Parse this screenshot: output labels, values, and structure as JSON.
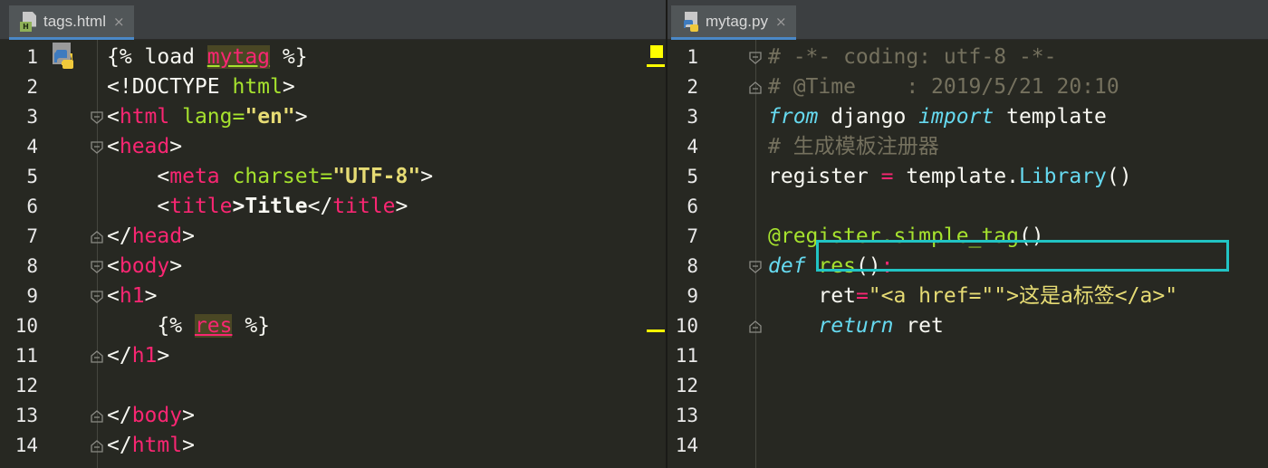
{
  "left_tab": {
    "label": "tags.html",
    "icon": "html-file-icon",
    "close": "×"
  },
  "right_tab": {
    "label": "mytag.py",
    "icon": "python-file-icon",
    "close": "×"
  },
  "left_lines": [
    {
      "n": "1",
      "segs": [
        [
          "plain",
          "{% load "
        ],
        [
          "tmpl-name tag",
          "mytag"
        ],
        [
          "plain",
          " %}"
        ]
      ]
    },
    {
      "n": "2",
      "segs": [
        [
          "plain",
          "<!DOCTYPE "
        ],
        [
          "attr",
          "html"
        ],
        [
          "plain",
          ">"
        ]
      ]
    },
    {
      "n": "3",
      "segs": [
        [
          "plain",
          "<"
        ],
        [
          "tag",
          "html "
        ],
        [
          "attr",
          "lang="
        ],
        [
          "str",
          "\"en\""
        ],
        [
          "plain",
          ">"
        ]
      ]
    },
    {
      "n": "4",
      "segs": [
        [
          "plain",
          "<"
        ],
        [
          "tag",
          "head"
        ],
        [
          "plain",
          ">"
        ]
      ]
    },
    {
      "n": "5",
      "segs": [
        [
          "plain",
          "    <"
        ],
        [
          "tag",
          "meta "
        ],
        [
          "attr",
          "charset="
        ],
        [
          "str",
          "\"UTF-8\""
        ],
        [
          "plain",
          ">"
        ]
      ]
    },
    {
      "n": "6",
      "segs": [
        [
          "plain",
          "    <"
        ],
        [
          "tag",
          "title"
        ],
        [
          "plain bold",
          ">Title"
        ],
        [
          "plain",
          "</"
        ],
        [
          "tag",
          "title"
        ],
        [
          "plain",
          ">"
        ]
      ]
    },
    {
      "n": "7",
      "segs": [
        [
          "plain",
          "</"
        ],
        [
          "tag",
          "head"
        ],
        [
          "plain",
          ">"
        ]
      ]
    },
    {
      "n": "8",
      "segs": [
        [
          "plain",
          "<"
        ],
        [
          "tag",
          "body"
        ],
        [
          "plain",
          ">"
        ]
      ]
    },
    {
      "n": "9",
      "segs": [
        [
          "plain",
          "<"
        ],
        [
          "tag",
          "h1"
        ],
        [
          "plain",
          ">"
        ]
      ]
    },
    {
      "n": "10",
      "segs": [
        [
          "plain",
          "    {% "
        ],
        [
          "tmpl-res",
          "res"
        ],
        [
          "plain",
          " %}"
        ]
      ]
    },
    {
      "n": "11",
      "segs": [
        [
          "plain",
          "</"
        ],
        [
          "tag",
          "h1"
        ],
        [
          "plain",
          ">"
        ]
      ]
    },
    {
      "n": "12",
      "segs": []
    },
    {
      "n": "13",
      "segs": [
        [
          "plain",
          "</"
        ],
        [
          "tag",
          "body"
        ],
        [
          "plain",
          ">"
        ]
      ]
    },
    {
      "n": "14",
      "segs": [
        [
          "plain",
          "</"
        ],
        [
          "tag",
          "html"
        ],
        [
          "plain",
          ">"
        ]
      ]
    }
  ],
  "right_lines": [
    {
      "n": "1",
      "segs": [
        [
          "cmt",
          "# -*- coding: utf-8 -*-"
        ]
      ]
    },
    {
      "n": "2",
      "segs": [
        [
          "cmt",
          "# @Time    : 2019/5/21 20:10"
        ]
      ]
    },
    {
      "n": "3",
      "segs": [
        [
          "kw",
          "from"
        ],
        [
          "plain",
          " django "
        ],
        [
          "kw",
          "import"
        ],
        [
          "plain",
          " template"
        ]
      ]
    },
    {
      "n": "4",
      "segs": [
        [
          "cmt",
          "# 生成模板注册器"
        ]
      ]
    },
    {
      "n": "5",
      "segs": [
        [
          "plain",
          "register "
        ],
        [
          "op",
          "="
        ],
        [
          "plain",
          " template."
        ],
        [
          "cls",
          "Library"
        ],
        [
          "plain",
          "()"
        ]
      ]
    },
    {
      "n": "6",
      "segs": []
    },
    {
      "n": "7",
      "segs": [
        [
          "fn",
          "@register.simple_tag"
        ],
        [
          "plain",
          "()"
        ]
      ]
    },
    {
      "n": "8",
      "segs": [
        [
          "kw",
          "def"
        ],
        [
          "plain",
          " "
        ],
        [
          "fn",
          "res"
        ],
        [
          "plain",
          "()"
        ],
        [
          "op",
          ":"
        ]
      ]
    },
    {
      "n": "9",
      "segs": [
        [
          "plain",
          "    ret"
        ],
        [
          "op",
          "="
        ],
        [
          "pystr",
          "\"<a href=\"\">这是a标签</a>\""
        ]
      ]
    },
    {
      "n": "10",
      "segs": [
        [
          "plain",
          "    "
        ],
        [
          "kw",
          "return"
        ],
        [
          "plain",
          " ret"
        ]
      ]
    },
    {
      "n": "11",
      "segs": []
    },
    {
      "n": "12",
      "segs": []
    },
    {
      "n": "13",
      "segs": []
    },
    {
      "n": "14",
      "segs": []
    }
  ],
  "colors": {
    "editor_bg": "#272822",
    "tab_bg": "#515658",
    "highlight_box": "#21c4c4",
    "marker": "#ffff00"
  }
}
